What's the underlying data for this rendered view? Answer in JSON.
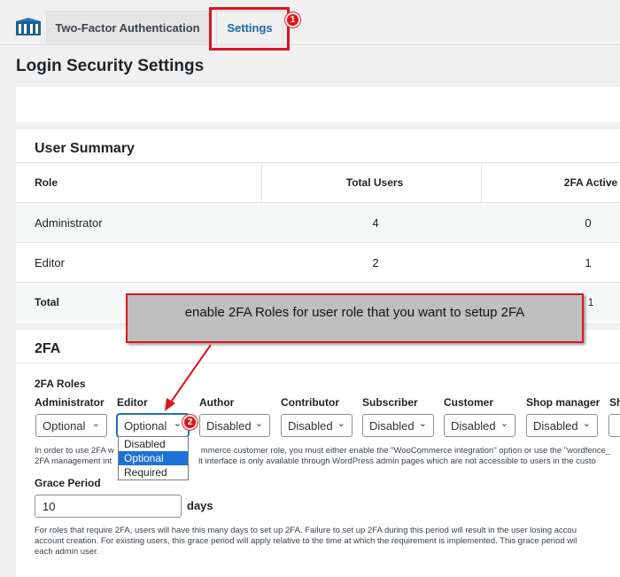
{
  "tabs": {
    "two_factor": "Two-Factor Authentication",
    "settings": "Settings"
  },
  "badges": {
    "one": "1",
    "two": "2"
  },
  "page_title": "Login Security Settings",
  "user_summary": {
    "title": "User Summary",
    "headers": [
      "Role",
      "Total Users",
      "2FA Active"
    ],
    "rows": [
      {
        "role": "Administrator",
        "total": "4",
        "active": "0"
      },
      {
        "role": "Editor",
        "total": "2",
        "active": "1"
      }
    ],
    "total_label": "Total",
    "total_active": "1"
  },
  "callout_text": "enable 2FA Roles for user role that you want to setup 2FA",
  "twofa": {
    "title": "2FA",
    "roles_label": "2FA Roles",
    "roles": [
      {
        "name": "Administrator",
        "value": "Optional"
      },
      {
        "name": "Editor",
        "value": "Optional"
      },
      {
        "name": "Author",
        "value": "Disabled"
      },
      {
        "name": "Contributor",
        "value": "Disabled"
      },
      {
        "name": "Subscriber",
        "value": "Disabled"
      },
      {
        "name": "Customer",
        "value": "Disabled"
      },
      {
        "name": "Shop manager",
        "value": "Disabled"
      },
      {
        "name": "Sh",
        "value": ""
      }
    ],
    "dropdown_options": [
      "Disabled",
      "Optional",
      "Required"
    ],
    "note_line1_a": "In order to use 2FA w",
    "note_line1_b": "mmerce customer role, you must either enable the \"WooCommerce integration\" option or use the \"wordfence_",
    "note_line2_a": "2FA management int",
    "note_line2_b": "lt interface is only available through WordPress admin pages which are not accessible to users in the custo",
    "grace_label": "Grace Period",
    "grace_value": "10",
    "grace_unit": "days",
    "grace_note_1": "For roles that require 2FA, users will have this many days to set up 2FA. Failure to set up 2FA during this period will result in the user losing accou",
    "grace_note_2": "account creation. For existing users, this grace period will apply relative to the time at which the requirement is implemented. This grace period wil",
    "grace_note_3": "each admin user."
  }
}
